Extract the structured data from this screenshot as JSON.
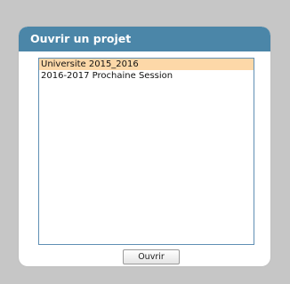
{
  "dialog": {
    "title": "Ouvrir un projet",
    "header_color": "#4b86a8"
  },
  "projects": {
    "items": [
      {
        "label": "Universite 2015_2016",
        "selected": true
      },
      {
        "label": "2016-2017 Prochaine Session",
        "selected": false
      }
    ],
    "selected_color": "#fdd8a8"
  },
  "actions": {
    "open_label": "Ouvrir"
  }
}
